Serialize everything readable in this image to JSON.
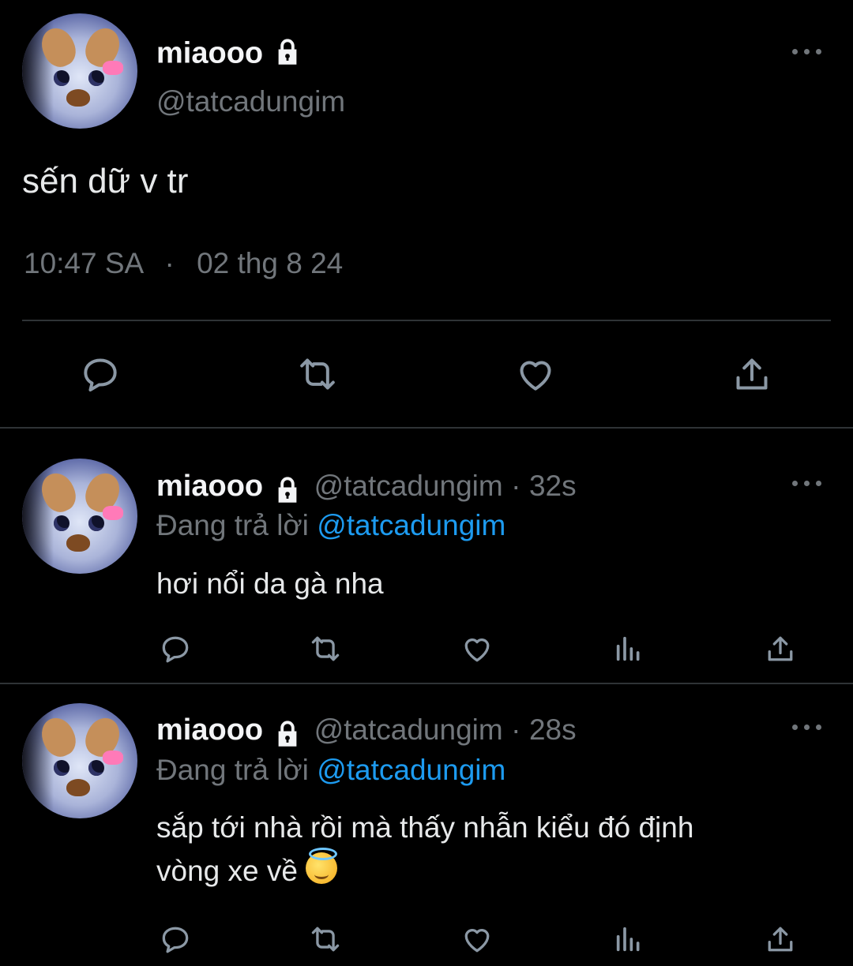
{
  "main_tweet": {
    "display_name": "miaooo",
    "handle": "@tatcadungim",
    "text": "sến dữ v tr",
    "time": "10:47 SA",
    "dot": "·",
    "date": "02 thg 8 24"
  },
  "replies": [
    {
      "display_name": "miaooo",
      "handle": "@tatcadungim",
      "dot": "·",
      "age": "32s",
      "replying_prefix": "Đang trả lời",
      "replying_to": "@tatcadungim",
      "text": "hơi nổi da gà nha"
    },
    {
      "display_name": "miaooo",
      "handle": "@tatcadungim",
      "dot": "·",
      "age": "28s",
      "replying_prefix": "Đang trả lời",
      "replying_to": "@tatcadungim",
      "text_line1": "sắp tới nhà rồi mà thấy nhẫn kiểu đó định",
      "text_line2": "vòng xe về",
      "emoji": "smiling-face-with-halo"
    }
  ],
  "icons": {
    "reply": "speech-bubble-icon",
    "retweet": "retweet-icon",
    "like": "heart-icon",
    "views": "bar-chart-icon",
    "share": "share-icon",
    "more": "more-dots-icon",
    "protected": "lock-icon"
  },
  "colors": {
    "background": "#000000",
    "text": "#e7e9ea",
    "muted": "#71767b",
    "link": "#1d9bf0",
    "divider": "#2f3336"
  }
}
